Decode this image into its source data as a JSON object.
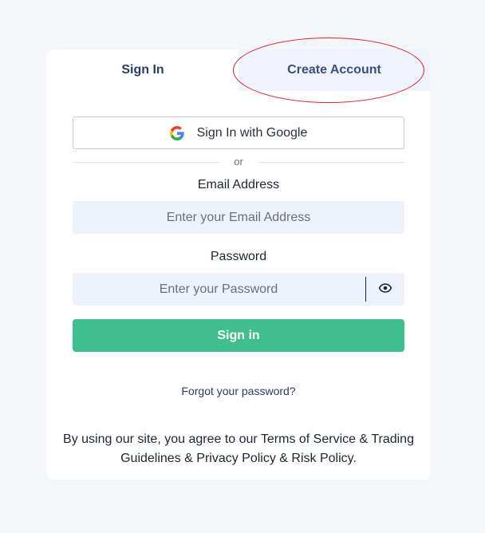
{
  "tabs": {
    "sign_in": "Sign In",
    "create_account": "Create Account"
  },
  "google_button": {
    "label": "Sign In with Google",
    "icon": "google-logo-icon"
  },
  "divider_text": "or",
  "email": {
    "label": "Email Address",
    "placeholder": "Enter your Email Address",
    "value": ""
  },
  "password": {
    "label": "Password",
    "placeholder": "Enter your Password",
    "value": "",
    "toggle_icon": "eye-icon"
  },
  "submit_label": "Sign in",
  "forgot_link": "Forgot your password?",
  "terms": {
    "prefix": "By using our site, you agree to our ",
    "tos": "Terms of Service",
    "amp1": " & ",
    "trading": "Trading Guidelines",
    "amp2": " & ",
    "privacy": "Privacy Policy",
    "amp3": " & ",
    "risk": "Risk Policy",
    "suffix": "."
  },
  "colors": {
    "primary_button": "#3fbf90",
    "tab_active_text": "#2a3d68",
    "input_bg": "#eef2fd",
    "highlight_ring": "#d9252d"
  }
}
